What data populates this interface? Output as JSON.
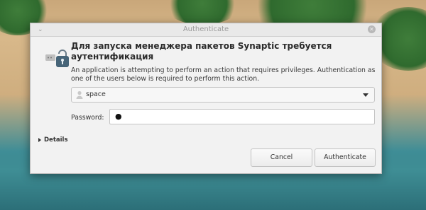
{
  "window": {
    "title": "Authenticate",
    "minimize_glyph": "⌄",
    "close_glyph": "✕"
  },
  "dialog": {
    "heading": "Для запуска менеджера пакетов Synaptic требуется аутентификация",
    "description": "An application is attempting to perform an action that requires privileges. Authentication as one of the users below is required to perform this action.",
    "icon": "lock-keys-icon"
  },
  "user_select": {
    "selected": "space",
    "icon": "user-icon"
  },
  "password": {
    "label": "Password:",
    "value": "●"
  },
  "details": {
    "label": "Details"
  },
  "buttons": {
    "cancel": "Cancel",
    "authenticate": "Authenticate"
  }
}
